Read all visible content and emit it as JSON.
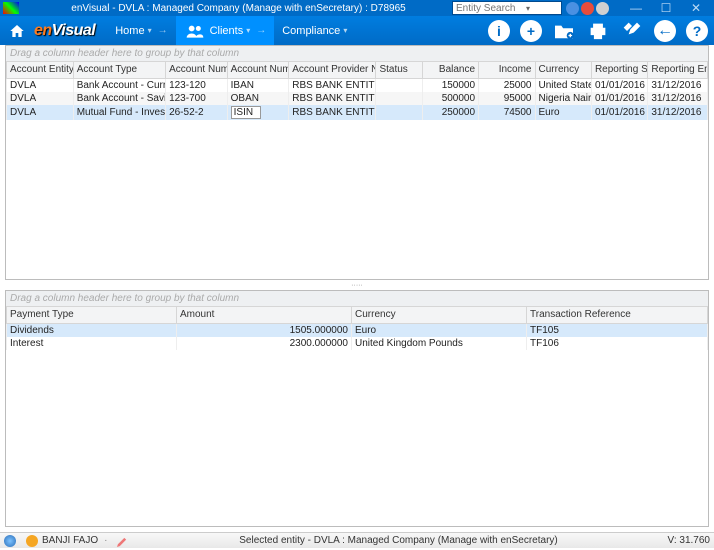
{
  "titlebar": {
    "title": "enVisual - DVLA : Managed Company (Manage with enSecretary) : D78965",
    "search_placeholder": "Entity Search"
  },
  "nav": {
    "logo_pre": "en",
    "logo_post": "Visual",
    "home": "Home",
    "clients": "Clients",
    "compliance": "Compliance"
  },
  "group_hint": "Drag a column header here to group by that column",
  "table1": {
    "headers": [
      "Account Entity Nam",
      "Account Type",
      "Account Number",
      "Account Number",
      "Account Provider Name",
      "Status",
      "Balance",
      "Income",
      "Currency",
      "Reporting Start D",
      "Reporting End Da"
    ],
    "rows": [
      {
        "entity": "DVLA",
        "type": "Bank Account - Current",
        "num": "123-120",
        "num2": "IBAN",
        "provider": "RBS BANK ENTITY",
        "status": "",
        "balance": "150000",
        "income": "25000",
        "currency": "United States ...",
        "start": "01/01/2016",
        "end": "31/12/2016"
      },
      {
        "entity": "DVLA",
        "type": "Bank Account - Savings",
        "num": "123-700",
        "num2": "OBAN",
        "provider": "RBS BANK ENTITY",
        "status": "",
        "balance": "500000",
        "income": "95000",
        "currency": "Nigeria Nairas",
        "start": "01/01/2016",
        "end": "31/12/2016"
      },
      {
        "entity": "DVLA",
        "type": "Mutual Fund - Investment",
        "num": "26-52-2",
        "num2": "ISIN",
        "provider": "RBS BANK ENTITY",
        "status": "",
        "balance": "250000",
        "income": "74500",
        "currency": "Euro",
        "start": "01/01/2016",
        "end": "31/12/2016"
      }
    ]
  },
  "table2": {
    "headers": [
      "Payment Type",
      "Amount",
      "Currency",
      "Transaction Reference"
    ],
    "rows": [
      {
        "ptype": "Dividends",
        "amount": "1505.000000",
        "currency": "Euro",
        "ref": "TF105"
      },
      {
        "ptype": "Interest",
        "amount": "2300.000000",
        "currency": "United Kingdom Pounds",
        "ref": "TF106"
      }
    ]
  },
  "status": {
    "user": "BANJI FAJO",
    "entity": "Selected entity - DVLA : Managed Company (Manage with enSecretary)",
    "version": "V: 31.760"
  }
}
